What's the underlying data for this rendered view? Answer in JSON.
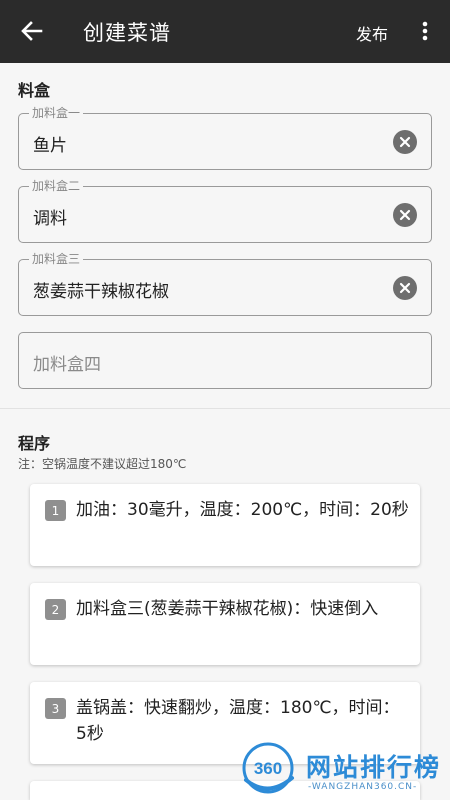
{
  "appbar": {
    "title": "创建菜谱",
    "publish_label": "发布"
  },
  "ingredients": {
    "title": "料盒",
    "boxes": [
      {
        "label": "加料盒一",
        "value": "鱼片"
      },
      {
        "label": "加料盒二",
        "value": "调料"
      },
      {
        "label": "加料盒三",
        "value": "葱姜蒜干辣椒花椒"
      },
      {
        "placeholder": "加料盒四"
      }
    ]
  },
  "program": {
    "title": "程序",
    "note": "注：空锅温度不建议超过180℃",
    "steps": [
      {
        "num": "1",
        "text": "加油：30毫升，温度：200℃，时间：20秒"
      },
      {
        "num": "2",
        "text": "加料盒三(葱姜蒜干辣椒花椒)：快速倒入"
      },
      {
        "num": "3",
        "text": "盖锅盖：快速翻炒，温度：180℃，时间：5秒"
      }
    ]
  },
  "watermark": {
    "logo_text": "360",
    "name": "网站排行榜",
    "url": "-WANGZHAN360.CN-"
  },
  "colors": {
    "appbar": "#2b2b2b",
    "background": "#f6f6f6",
    "watermark": "#2d8bd7"
  }
}
